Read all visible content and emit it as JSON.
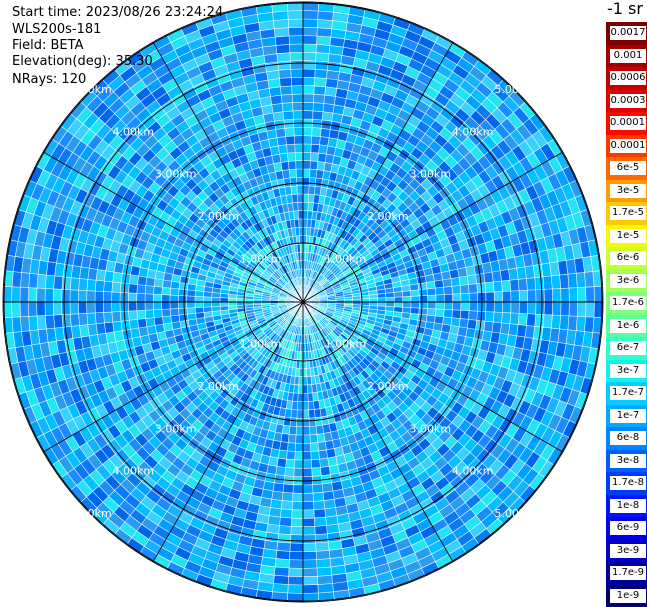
{
  "header": {
    "start_time": "Start time: 2023/08/26 23:24:24",
    "instrument": "WLS200s-181",
    "field": "Field: BETA",
    "elevation": "Elevation(deg): 35.30",
    "nrays": "NRays: 120"
  },
  "colorbar": {
    "unit": "-1 sr",
    "labels": [
      "0.0017",
      "0.001",
      "0.0006",
      "0.0003",
      "0.00017",
      "0.0001",
      "6e-5",
      "3e-5",
      "1.7e-5",
      "1e-5",
      "6e-6",
      "3e-6",
      "1.7e-6",
      "1e-6",
      "6e-7",
      "3e-7",
      "1.7e-7",
      "1e-7",
      "6e-8",
      "3e-8",
      "1.7e-8",
      "1e-8",
      "6e-9",
      "3e-9",
      "1.7e-9",
      "1e-9"
    ],
    "colors": [
      "#7f0000",
      "#a00000",
      "#c20000",
      "#e30000",
      "#ff0800",
      "#ff3800",
      "#ff6900",
      "#ff9a00",
      "#ffc900",
      "#f6f900",
      "#c7ff30",
      "#a0ff57",
      "#7dff7a",
      "#57ffa0",
      "#30ffc7",
      "#0cf4eb",
      "#00ccff",
      "#00a8ff",
      "#0084ff",
      "#0060ff",
      "#003cff",
      "#0014ff",
      "#0000f1",
      "#0000c6",
      "#00009c",
      "#000070"
    ]
  },
  "chart_data": {
    "type": "heatmap",
    "projection": "polar PPI",
    "rays": 120,
    "range_unit": "km",
    "ring_labels": [
      "1.00km",
      "2.00km",
      "3.00km",
      "4.00km",
      "5.00km"
    ],
    "rings_km": [
      1,
      2,
      3,
      4,
      5
    ],
    "max_range_km": 5,
    "spoke_step_deg": 30,
    "dominant_value_range": [
      "6e-9",
      "1e-7"
    ],
    "near_center_value": "1.7e-7"
  }
}
